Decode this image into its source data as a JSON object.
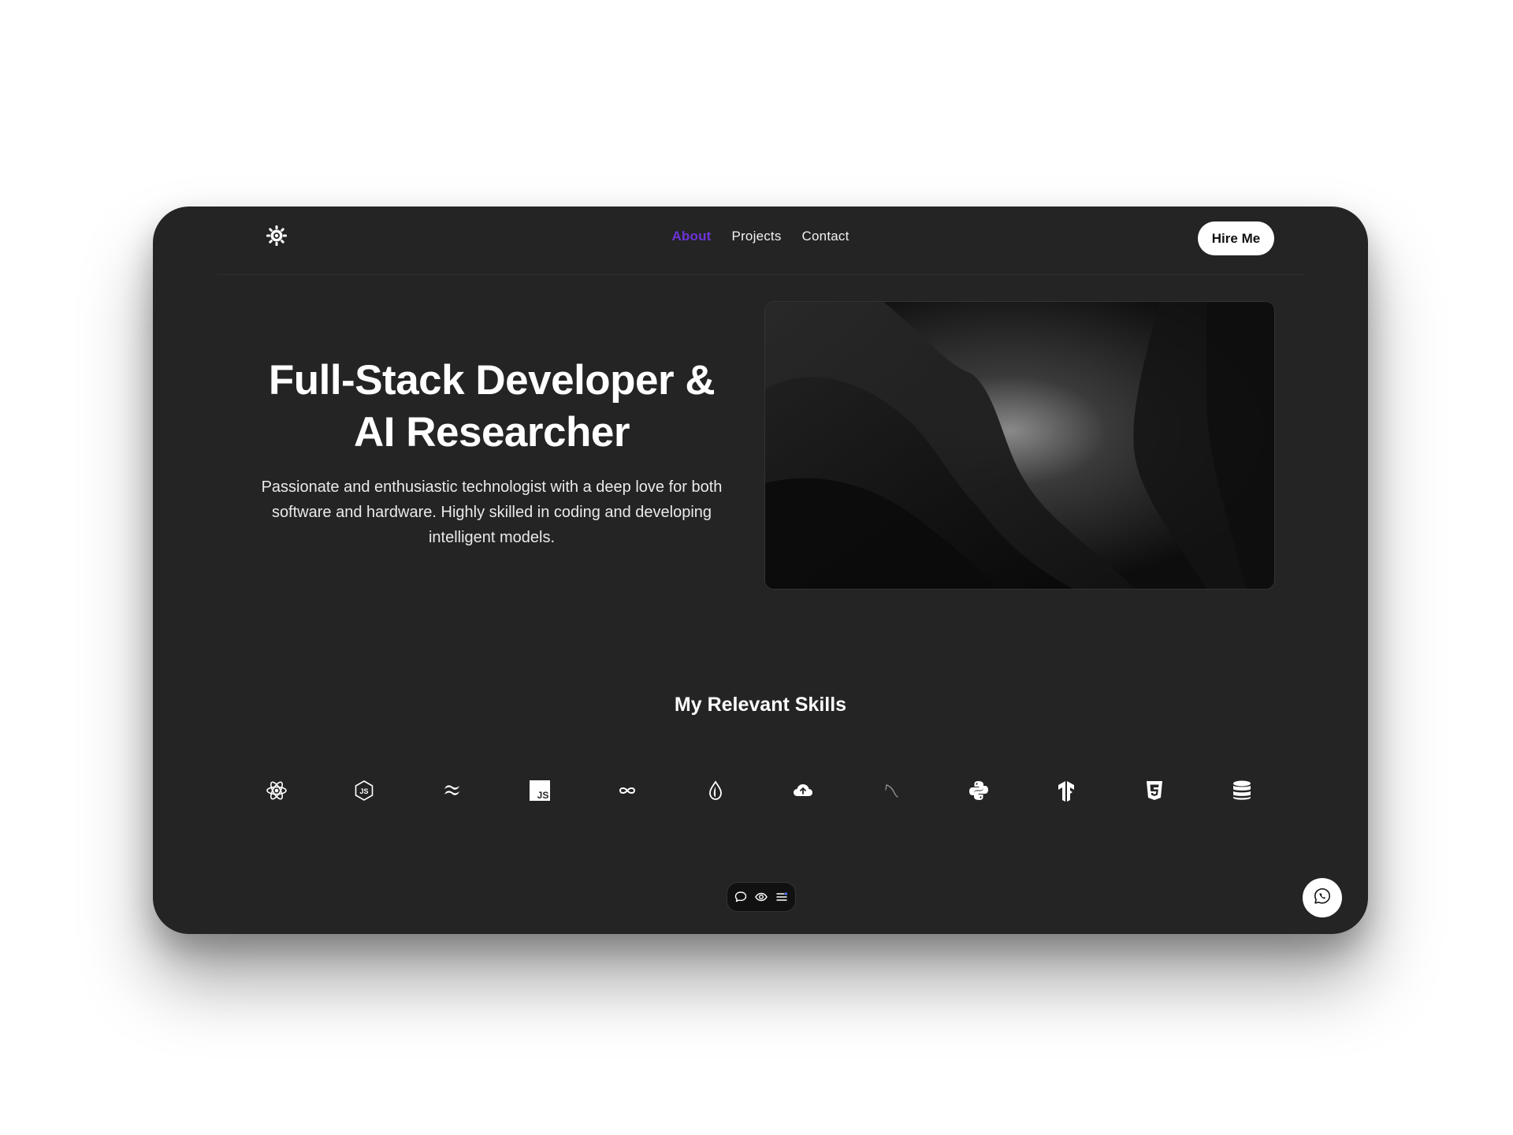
{
  "header": {
    "logo_icon": "gear-sun-icon",
    "nav": [
      {
        "label": "About",
        "active": true
      },
      {
        "label": "Projects",
        "active": false
      },
      {
        "label": "Contact",
        "active": false
      }
    ],
    "hire_label": "Hire Me"
  },
  "hero": {
    "title_lines": [
      "Full-Stack Developer &",
      "AI Researcher"
    ],
    "description_lines": [
      "Passionate and enthusiastic technologist with a deep love for both",
      "software and hardware. Highly skilled in coding and developing",
      "intelligent models."
    ],
    "image": "dark-abstract-wave-image"
  },
  "skills": {
    "title": "My Relevant Skills",
    "icons": [
      "react-icon",
      "nodejs-icon",
      "tailwind-icon",
      "javascript-icon",
      "infinity-icon",
      "drop-icon",
      "cloud-icon",
      "mysql-icon",
      "python-icon",
      "tensorflow-icon",
      "css3-icon",
      "database-icon"
    ]
  },
  "dock": {
    "icons": [
      "chat-bubble-icon",
      "eye-icon",
      "menu-icon"
    ]
  },
  "fab": {
    "icon": "whatsapp-icon"
  },
  "colors": {
    "accent": "#6d33d9",
    "window_bg": "#242424",
    "page_bg": "#ffffff"
  }
}
